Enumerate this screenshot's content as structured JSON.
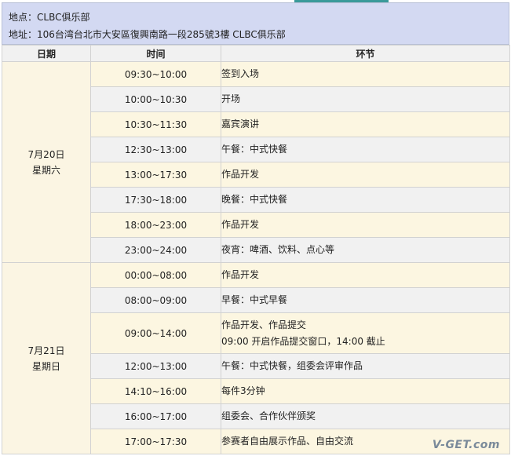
{
  "location": {
    "venue_line": "地点：CLBC俱乐部",
    "address_line": "地址：106台湾台北市大安區復興南路一段285號3樓 CLBC俱乐部"
  },
  "table": {
    "headers": [
      "日期",
      "时间",
      "环节"
    ],
    "days": [
      {
        "date": "7月20日",
        "weekday": "星期六",
        "rows": [
          {
            "time": "09:30~10:00",
            "activity": [
              "签到入场"
            ]
          },
          {
            "time": "10:00~10:30",
            "activity": [
              "开场"
            ]
          },
          {
            "time": "10:30~11:30",
            "activity": [
              "嘉宾演讲"
            ]
          },
          {
            "time": "12:30~13:00",
            "activity": [
              "午餐：中式快餐"
            ]
          },
          {
            "time": "13:00~17:30",
            "activity": [
              "作品开发"
            ]
          },
          {
            "time": "17:30~18:00",
            "activity": [
              "晚餐：中式快餐"
            ]
          },
          {
            "time": "18:00~23:00",
            "activity": [
              "作品开发"
            ]
          },
          {
            "time": "23:00~24:00",
            "activity": [
              "夜宵：啤酒、饮料、点心等"
            ]
          }
        ]
      },
      {
        "date": "7月21日",
        "weekday": "星期日",
        "rows": [
          {
            "time": "00:00~08:00",
            "activity": [
              "作品开发"
            ]
          },
          {
            "time": "08:00~09:00",
            "activity": [
              "早餐：中式早餐"
            ]
          },
          {
            "time": "09:00~14:00",
            "activity": [
              "作品开发、作品提交",
              "09:00 开启作品提交窗口，14:00 截止"
            ]
          },
          {
            "time": "12:00~13:00",
            "activity": [
              "午餐：中式快餐，组委会评审作品"
            ]
          },
          {
            "time": "14:10~16:00",
            "activity": [
              "每件3分钟"
            ]
          },
          {
            "time": "16:00~17:00",
            "activity": [
              "组委会、合作伙伴颁奖"
            ]
          },
          {
            "time": "17:00~17:30",
            "activity": [
              "参赛者自由展示作品、自由交流"
            ]
          }
        ]
      }
    ]
  },
  "watermark": "V-GET.com"
}
